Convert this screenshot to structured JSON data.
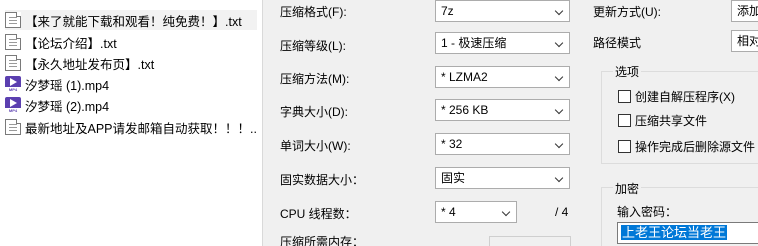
{
  "files": [
    {
      "name": "【来了就能下载和观看！纯免费！】.txt",
      "icon": "text-file-icon"
    },
    {
      "name": "【论坛介绍】.txt",
      "icon": "text-file-icon"
    },
    {
      "name": "【永久地址发布页】.txt",
      "icon": "text-file-icon"
    },
    {
      "name": "汐梦瑶 (1).mp4",
      "icon": "mp4-file-icon",
      "tag": "MP4"
    },
    {
      "name": "汐梦瑶 (2).mp4",
      "icon": "mp4-file-icon",
      "tag": "MP4"
    },
    {
      "name": "最新地址及APP请发邮箱自动获取！！！....",
      "icon": "text-file-icon"
    }
  ],
  "settings": {
    "format_label": "压缩格式(F):",
    "format_value": "7z",
    "level_label": "压缩等级(L):",
    "level_value": "1 - 极速压缩",
    "method_label": "压缩方法(M):",
    "method_value": "* LZMA2",
    "dict_label": "字典大小(D):",
    "dict_value": "* 256 KB",
    "word_label": "单词大小(W):",
    "word_value": "* 32",
    "solid_label": "固实数据大小：",
    "solid_value": "固实",
    "cpu_label": "CPU 线程数：",
    "cpu_value": "* 4",
    "cpu_total": "/ 4",
    "memory_label": "压缩所需内存："
  },
  "right": {
    "update_label": "更新方式(U):",
    "update_value": "添加",
    "path_label": "路径模式",
    "path_value": "相对",
    "options_title": "选项",
    "options": [
      "创建自解压程序(X)",
      "压缩共享文件",
      "操作完成后删除源文件"
    ],
    "encrypt_title": "加密",
    "password_label": "输入密码：",
    "password_value": "上老王论坛当老王"
  },
  "colors": {
    "selection": "#0078d7",
    "mp4_icon": "#5b3fb0",
    "dialog_bg": "#f0f0f0"
  }
}
